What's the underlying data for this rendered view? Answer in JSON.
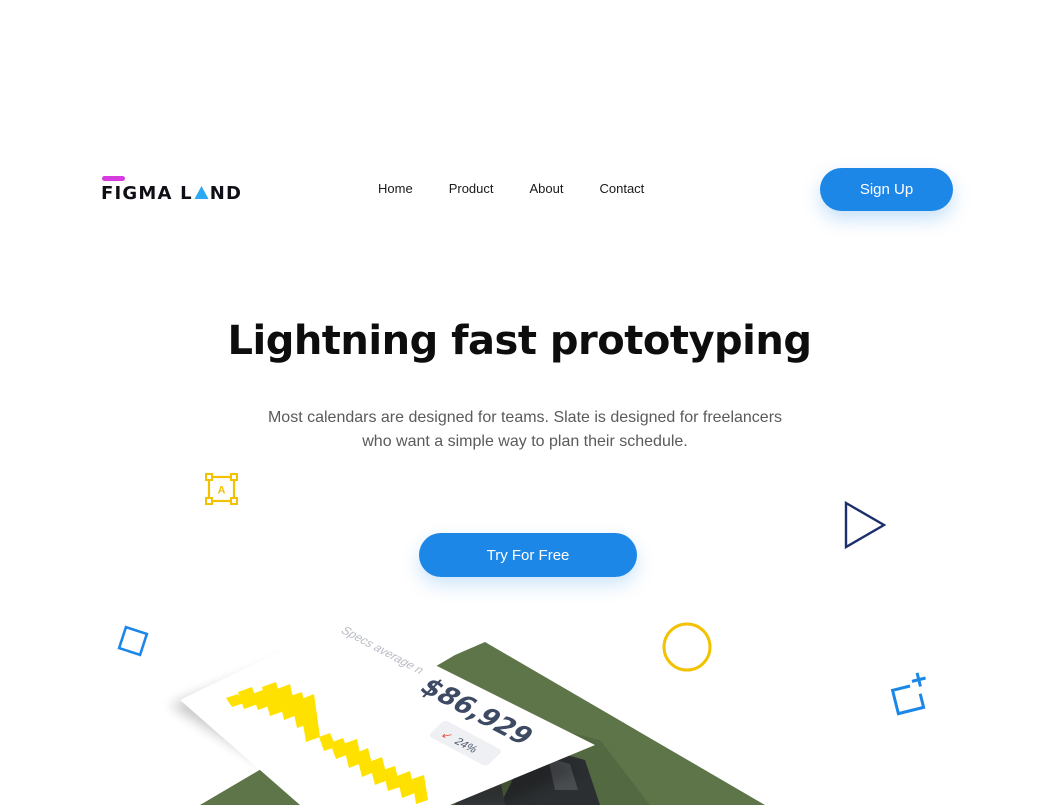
{
  "brand": {
    "name_part1": "FIGMA L",
    "name_part2": "ND"
  },
  "nav": {
    "items": [
      "Home",
      "Product",
      "About",
      "Contact"
    ]
  },
  "header": {
    "signup_label": "Sign Up"
  },
  "hero": {
    "title": "Lightning fast prototyping",
    "subtitle": "Most calendars are designed for teams. Slate is designed for freelancers who want a simple way to plan their schedule.",
    "cta_label": "Try For Free"
  },
  "mockup": {
    "card_label": "Specs average n",
    "amount": "$86,929",
    "change": "24%"
  },
  "colors": {
    "accent": "#1d87e8",
    "logo_bar": "#d63ce0",
    "logo_triangle": "#2aa8f2",
    "yellow": "#f2c200",
    "navy": "#1c2e6b",
    "blue": "#1d87e8",
    "chart_yellow": "#ffe100"
  },
  "icons": [
    "text-frame-icon",
    "play-triangle-icon",
    "square-outline-icon",
    "circle-outline-icon",
    "add-frame-icon",
    "down-arrow-icon"
  ]
}
